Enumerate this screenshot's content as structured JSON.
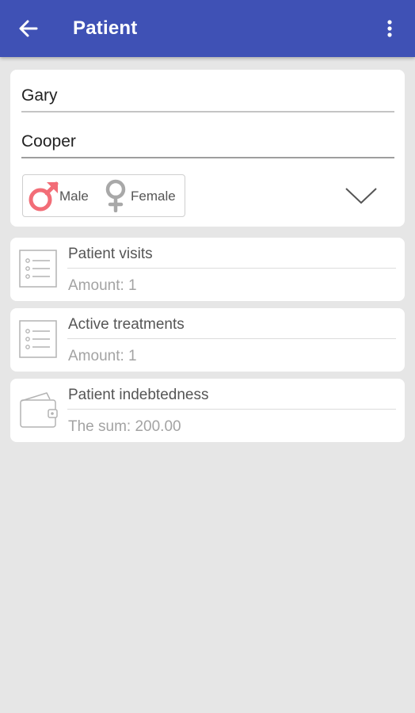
{
  "appbar": {
    "title": "Patient",
    "back_icon": "arrow-left-icon",
    "more_icon": "more-vert-icon",
    "background": "#3f51b5"
  },
  "patient": {
    "first_name": "Gary",
    "last_name": "Cooper",
    "gender": {
      "male_label": "Male",
      "female_label": "Female",
      "selected": "Male",
      "male_color": "#f26d77",
      "female_color": "#a8a8a8"
    },
    "expand_icon": "chevron-down-icon"
  },
  "cards": {
    "visits": {
      "title": "Patient visits",
      "subtitle": "Amount: 1",
      "icon": "list-icon"
    },
    "treatments": {
      "title": "Active treatments",
      "subtitle": "Amount: 1",
      "icon": "list-icon"
    },
    "debt": {
      "title": "Patient indebtedness",
      "subtitle": "The sum: 200.00",
      "icon": "wallet-icon"
    }
  }
}
